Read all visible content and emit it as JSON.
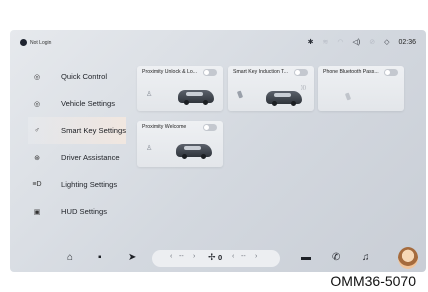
{
  "status_bar": {
    "login_text": "Not Login",
    "time": "02:36",
    "icons": [
      "bluetooth-icon",
      "signal-icon",
      "wifi-icon",
      "volume-icon",
      "mute-icon",
      "navigation-icon"
    ]
  },
  "sidebar": {
    "items": [
      {
        "label": "Quick Control",
        "icon": "quick-control-icon",
        "glyph": "◎"
      },
      {
        "label": "Vehicle Settings",
        "icon": "vehicle-settings-icon",
        "glyph": "◎"
      },
      {
        "label": "Smart Key Settings",
        "icon": "smart-key-icon",
        "glyph": "♂",
        "active": true
      },
      {
        "label": "Driver Assistance",
        "icon": "driver-assistance-icon",
        "glyph": "⊛"
      },
      {
        "label": "Lighting Settings",
        "icon": "lighting-icon",
        "glyph": "≡D"
      },
      {
        "label": "HUD Settings",
        "icon": "hud-icon",
        "glyph": "▣"
      }
    ]
  },
  "cards": [
    {
      "title": "Proximity Unlock & Lo...",
      "toggle_on": false
    },
    {
      "title": "Smart Key Induction T...",
      "toggle_on": false
    },
    {
      "title": "Phone Bluetooth Pass...",
      "toggle_on": false
    },
    {
      "title": "Proximity Welcome",
      "toggle_on": false
    }
  ],
  "dock": {
    "home_icon": "home-icon",
    "apps_icon": "apps-icon",
    "nav_icon": "navigation-arrow-icon",
    "climate": {
      "left_temp": "--",
      "fan_value": "0",
      "right_temp": "--"
    },
    "car_icon": "car-icon",
    "phone_icon": "phone-icon",
    "music_icon": "music-icon"
  },
  "caption": "OMM36-5070"
}
